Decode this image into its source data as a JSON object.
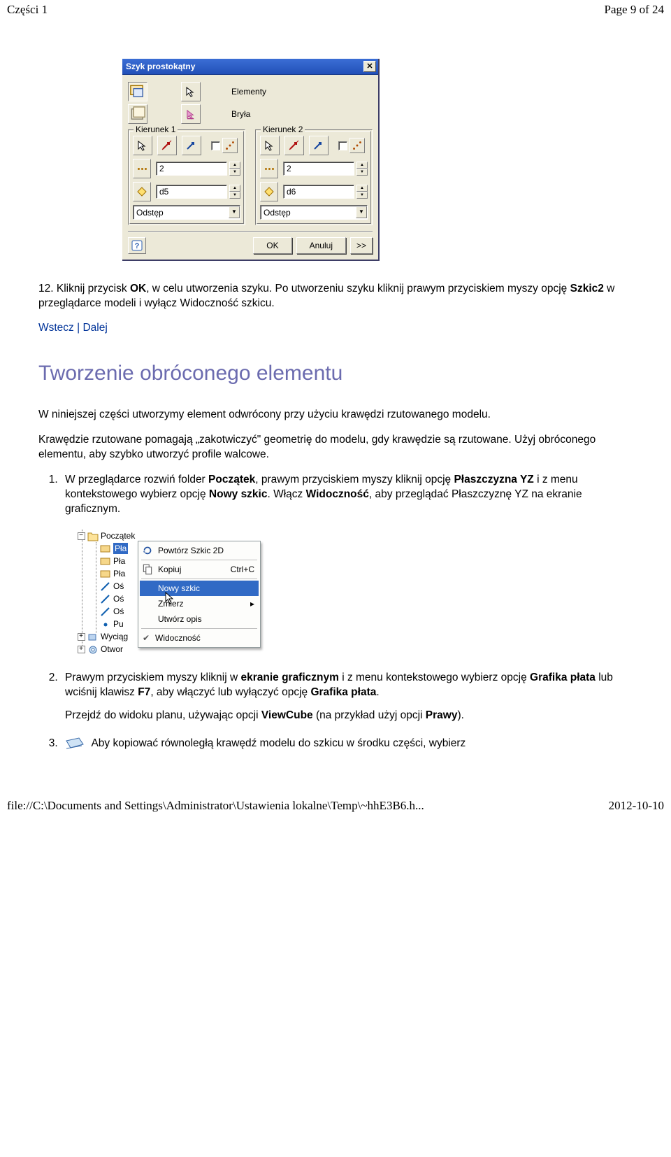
{
  "header": {
    "left": "Części 1",
    "right": "Page 9 of 24"
  },
  "dialog": {
    "title": "Szyk prostokątny",
    "topRows": [
      {
        "label": "Elementy"
      },
      {
        "label": "Bryła"
      }
    ],
    "group1": {
      "label": "Kierunek 1",
      "count": "2",
      "dim": "d5",
      "spacing": "Odstęp"
    },
    "group2": {
      "label": "Kierunek 2",
      "count": "2",
      "dim": "d6",
      "spacing": "Odstęp"
    },
    "buttons": {
      "ok": "OK",
      "cancel": "Anuluj",
      "expand": ">>"
    }
  },
  "step12": {
    "prefix": "12.  Kliknij przycisk ",
    "bold1": "OK",
    "mid": ", w celu utworzenia szyku. Po utworzeniu szyku kliknij prawym przyciskiem myszy opcję ",
    "bold2": "Szkic2",
    "tail": " w przeglądarce modeli i wyłącz Widoczność szkicu."
  },
  "nav": {
    "back": "Wstecz",
    "sep": " | ",
    "next": "Dalej"
  },
  "section2": {
    "title": "Tworzenie obróconego elementu",
    "p1": "W niniejszej części utworzymy element odwrócony przy użyciu krawędzi rzutowanego modelu.",
    "p2": "Krawędzie rzutowane pomagają „zakotwiczyć\" geometrię do modelu, gdy krawędzie są rzutowane. Użyj obróconego elementu, aby szybko utworzyć profile walcowe.",
    "steps": {
      "s1a": "W przeglądarce rozwiń folder ",
      "s1b": "Początek",
      "s1c": ", prawym przyciskiem myszy kliknij opcję ",
      "s1d": "Płaszczyzna YZ",
      "s1e": " i z menu kontekstowego wybierz opcję ",
      "s1f": "Nowy szkic",
      "s1g": ". Włącz ",
      "s1h": "Widoczność",
      "s1i": ", aby przeglądać Płaszczyznę YZ na ekranie graficznym.",
      "s2a": "Prawym przyciskiem myszy kliknij w ",
      "s2b": "ekranie graficznym",
      "s2c": " i z menu kontekstowego wybierz opcję ",
      "s2d": "Grafika płata",
      "s2e": " lub wciśnij klawisz ",
      "s2f": "F7",
      "s2g": ", aby włączyć lub wyłączyć opcję ",
      "s2h": "Grafika płata",
      "s2i": ".",
      "s2j": "Przejdź do widoku planu, używając opcji ",
      "s2k": "ViewCube",
      "s2l": " (na przykład użyj opcji ",
      "s2m": "Prawy",
      "s2n": ").",
      "s3a": "Aby kopiować równoległą krawędź modelu do szkicu w środku części, wybierz"
    }
  },
  "tree": {
    "root": "Początek",
    "selLabel": "Pła",
    "items": [
      "Pła",
      "Pła",
      "Oś",
      "Oś",
      "Oś",
      "Pu"
    ],
    "bottom1": "Wyciąg",
    "bottom2": "Otwor"
  },
  "ctx": {
    "repeat": "Powtórz Szkic 2D",
    "copy": "Kopiuj",
    "copySc": "Ctrl+C",
    "newSketch": "Nowy szkic",
    "measure": "Zmierz",
    "createDesc": "Utwórz opis",
    "visibility": "Widoczność"
  },
  "footer": {
    "left": "file://C:\\Documents and Settings\\Administrator\\Ustawienia lokalne\\Temp\\~hhE3B6.h...",
    "right": "2012-10-10"
  }
}
